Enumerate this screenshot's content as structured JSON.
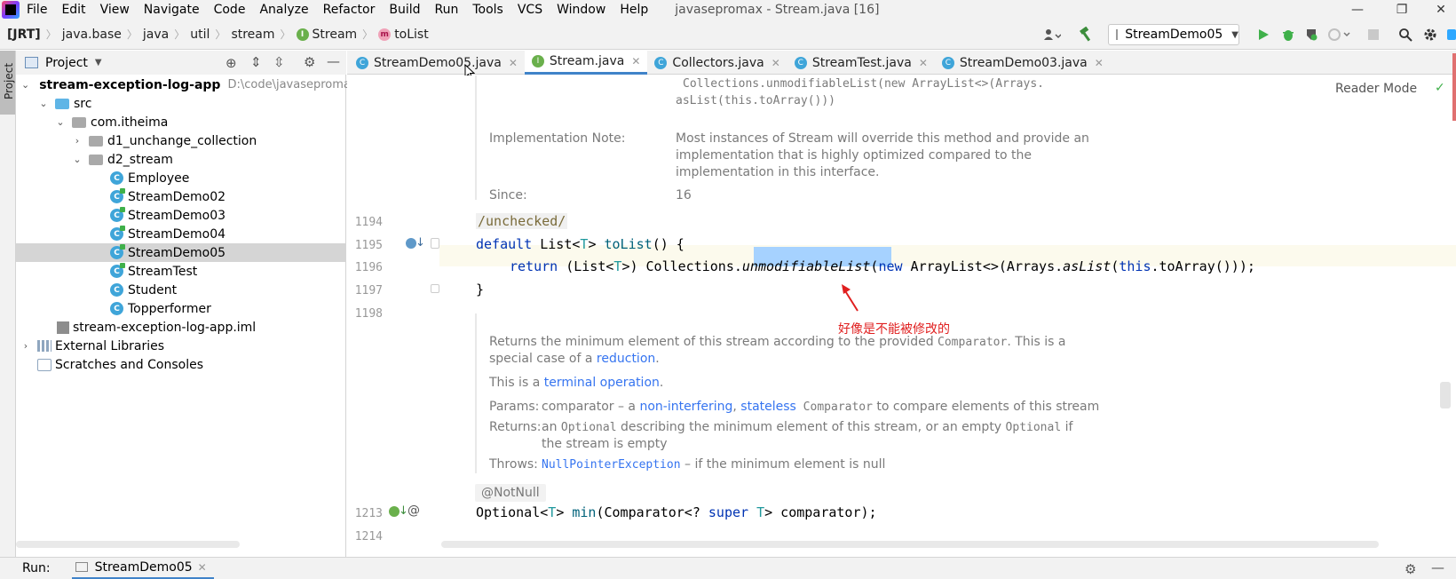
{
  "window": {
    "title": "javasepromax - Stream.java [16]",
    "minimize": "—",
    "restore": "❐",
    "close": "✕"
  },
  "menu": [
    "File",
    "Edit",
    "View",
    "Navigate",
    "Code",
    "Analyze",
    "Refactor",
    "Build",
    "Run",
    "Tools",
    "VCS",
    "Window",
    "Help"
  ],
  "breadcrumb": {
    "items": [
      "[JRT]",
      "java.base",
      "java",
      "util",
      "stream",
      "Stream",
      "toList"
    ],
    "stream_icon": "I",
    "tolist_icon": "m"
  },
  "toolbar": {
    "run_config": "StreamDemo05"
  },
  "left_stripe": {
    "label": "Project"
  },
  "project_panel": {
    "title": "Project",
    "tree": [
      {
        "label": "stream-exception-log-app",
        "path": "D:\\code\\javasepromax\\"
      },
      {
        "label": "src"
      },
      {
        "label": "com.itheima"
      },
      {
        "label": "d1_unchange_collection"
      },
      {
        "label": "d2_stream"
      },
      {
        "label": "Employee"
      },
      {
        "label": "StreamDemo02"
      },
      {
        "label": "StreamDemo03"
      },
      {
        "label": "StreamDemo04"
      },
      {
        "label": "StreamDemo05"
      },
      {
        "label": "StreamTest"
      },
      {
        "label": "Student"
      },
      {
        "label": "Topperformer"
      },
      {
        "label": "stream-exception-log-app.iml"
      },
      {
        "label": "External Libraries"
      },
      {
        "label": "Scratches and Consoles"
      }
    ]
  },
  "tabs": [
    {
      "label": "StreamDemo05.java",
      "icon": "C"
    },
    {
      "label": "Stream.java",
      "icon": "I"
    },
    {
      "label": "Collectors.java",
      "icon": "C"
    },
    {
      "label": "StreamTest.java",
      "icon": "C"
    },
    {
      "label": "StreamDemo03.java",
      "icon": "C"
    }
  ],
  "editor": {
    "reader_mode": "Reader Mode",
    "doc1": {
      "code_line1": "Collections.unmodifiableList(new ArrayList<>(Arrays.",
      "code_line2": "asList(this.toArray()))",
      "impl_label": "Implementation Note:",
      "impl_text1": "Most instances of Stream will override this method and provide an",
      "impl_text2": "implementation that is highly optimized compared to the",
      "impl_text3": "implementation in this interface.",
      "since_label": "Since:",
      "since_value": "16"
    },
    "line_numbers": [
      "1194",
      "1195",
      "1196",
      "1197",
      "1198",
      "1213",
      "1214"
    ],
    "code": {
      "l1194": "/unchecked/",
      "l1195_kw": "default",
      "l1195_type": "List<",
      "l1195_t": "T",
      "l1195_rest": "> ",
      "l1195_fn": "toList",
      "l1195_end": "() {",
      "l1196_kw": "return",
      "l1196_a": " (List<",
      "l1196_t": "T",
      "l1196_b": ">) Collections.",
      "l1196_sel": "unmodifiableList",
      "l1196_c": "(",
      "l1196_new": "new",
      "l1196_d": " ArrayList<>(Arrays.",
      "l1196_aslist": "asList",
      "l1196_e": "(",
      "l1196_this": "this",
      "l1196_f": ".toArray()));",
      "l1197": "}",
      "l1213_a": "Optional<",
      "l1213_t": "T",
      "l1213_b": "> ",
      "l1213_fn": "min",
      "l1213_c": "(Comparator<? ",
      "l1213_kw": "super",
      "l1213_t2": " T",
      "l1213_d": "> comparator);"
    },
    "annotation": "好像是不能被修改的",
    "doc2": {
      "p1_a": "Returns the minimum element of this stream according to the provided ",
      "p1_code": "Comparator",
      "p1_b": ". This is a",
      "p1_c": "special case of a ",
      "p1_link": "reduction",
      "p1_d": ".",
      "p2_a": "This is a ",
      "p2_link": "terminal operation",
      "p2_b": ".",
      "params_label": "Params:",
      "params_a": "comparator – a ",
      "params_link1": "non-interfering",
      "params_sep": ", ",
      "params_link2": "stateless",
      "params_code": " Comparator",
      "params_b": " to compare elements of this stream",
      "returns_label": "Returns:",
      "returns_a": "an ",
      "returns_code1": "Optional",
      "returns_b": " describing the minimum element of this stream, or an empty ",
      "returns_code2": "Optional",
      "returns_c": " if",
      "returns_d": "the stream is empty",
      "throws_label": "Throws:",
      "throws_code": "NullPointerException",
      "throws_b": " – if the minimum element is null"
    },
    "notnull": "@NotNull"
  },
  "run_bar": {
    "label": "Run:",
    "tab": "StreamDemo05"
  }
}
